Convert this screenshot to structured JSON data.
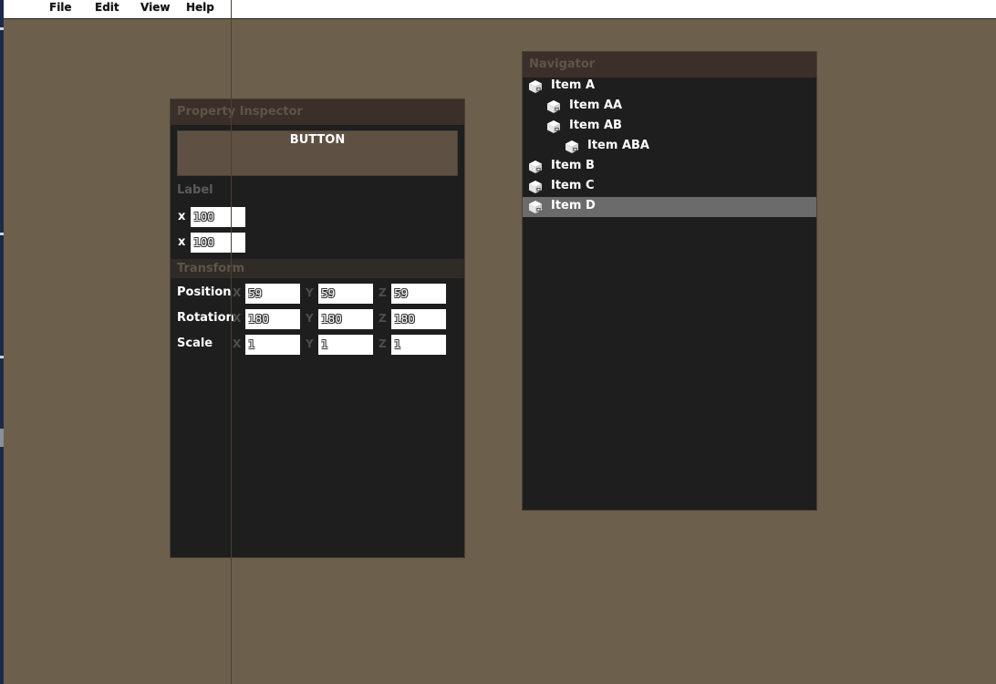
{
  "menu": [
    "File",
    "Edit",
    "View",
    "Help"
  ],
  "inspector": {
    "title": "Property Inspector",
    "button_label": "BUTTON",
    "label_section": "Label",
    "label_fields": [
      {
        "axis": "x",
        "value": "100"
      },
      {
        "axis": "x",
        "value": "100"
      }
    ],
    "transform_section": "Transform",
    "axes": [
      "X",
      "Y",
      "Z"
    ],
    "rows": [
      {
        "label": "Position",
        "values": [
          "59",
          "59",
          "59"
        ]
      },
      {
        "label": "Rotation",
        "values": [
          "180",
          "180",
          "180"
        ]
      },
      {
        "label": "Scale",
        "values": [
          "1",
          "1",
          "1"
        ]
      }
    ]
  },
  "navigator": {
    "title": "Navigator",
    "icon": "cube-icon",
    "items": [
      {
        "label": "Item A",
        "depth": 0,
        "selected": false
      },
      {
        "label": "Item AA",
        "depth": 1,
        "selected": false
      },
      {
        "label": "Item AB",
        "depth": 1,
        "selected": false
      },
      {
        "label": "Item ABA",
        "depth": 2,
        "selected": false
      },
      {
        "label": "Item B",
        "depth": 0,
        "selected": false
      },
      {
        "label": "Item C",
        "depth": 0,
        "selected": false
      },
      {
        "label": "Item D",
        "depth": 0,
        "selected": true
      }
    ]
  }
}
